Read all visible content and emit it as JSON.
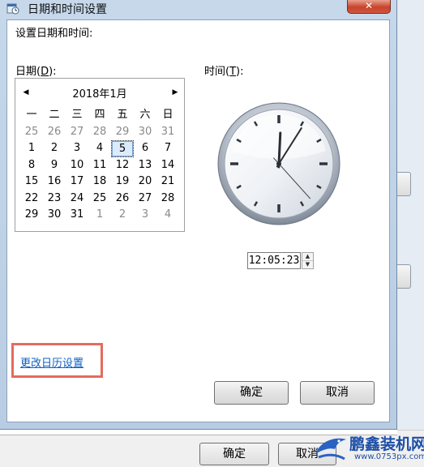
{
  "window": {
    "title": "日期和时间设置",
    "close_label": "✕"
  },
  "dialog": {
    "heading": "设置日期和时间:",
    "date_label_prefix": "日期(",
    "date_label_key": "D",
    "date_label_suffix": "):",
    "time_label_prefix": "时间(",
    "time_label_key": "T",
    "time_label_suffix": "):"
  },
  "calendar": {
    "month_title": "2018年1月",
    "prev_glyph": "◀",
    "next_glyph": "▶",
    "weekdays": [
      "一",
      "二",
      "三",
      "四",
      "五",
      "六",
      "日"
    ],
    "weeks": [
      [
        "25",
        "26",
        "27",
        "28",
        "29",
        "30",
        "31"
      ],
      [
        "1",
        "2",
        "3",
        "4",
        "5",
        "6",
        "7"
      ],
      [
        "8",
        "9",
        "10",
        "11",
        "12",
        "13",
        "14"
      ],
      [
        "15",
        "16",
        "17",
        "18",
        "19",
        "20",
        "21"
      ],
      [
        "22",
        "23",
        "24",
        "25",
        "26",
        "27",
        "28"
      ],
      [
        "29",
        "30",
        "31",
        "1",
        "2",
        "3",
        "4"
      ]
    ],
    "selected_day": "5"
  },
  "clock": {
    "hour": 12,
    "minute": 5,
    "second": 23
  },
  "time_input": {
    "value": "12:05:23"
  },
  "link": {
    "label": "更改日历设置"
  },
  "buttons": {
    "ok_label": "确定",
    "cancel_label": "取消"
  },
  "background_window": {
    "ok_label": "确定",
    "cancel_label": "取消"
  },
  "watermark": {
    "brand": "鹏鑫装机网",
    "url": "www.0753px.com"
  }
}
